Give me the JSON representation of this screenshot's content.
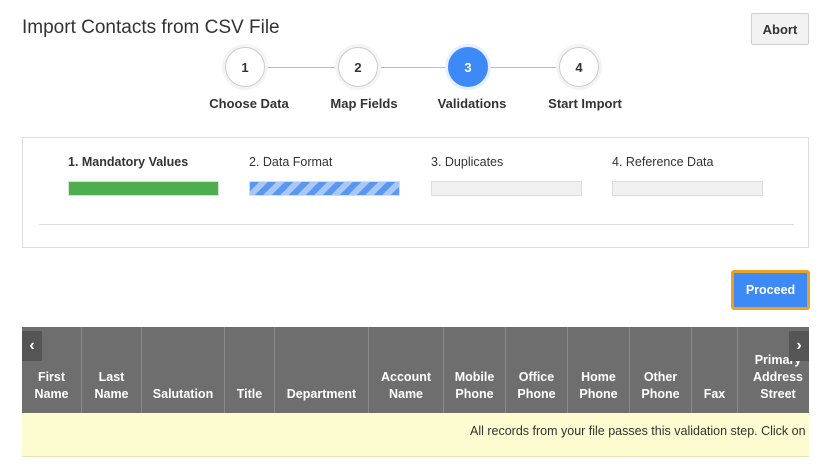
{
  "header": {
    "title": "Import Contacts from CSV File",
    "abort_label": "Abort"
  },
  "steps": [
    {
      "number": "1",
      "label": "Choose Data"
    },
    {
      "number": "2",
      "label": "Map Fields"
    },
    {
      "number": "3",
      "label": "Validations",
      "active": true
    },
    {
      "number": "4",
      "label": "Start Import"
    }
  ],
  "validations": [
    {
      "label": "1. Mandatory Values",
      "progress": 1.0,
      "state": "complete"
    },
    {
      "label": "2. Data Format",
      "progress": 1.0,
      "state": "in-progress"
    },
    {
      "label": "3. Duplicates",
      "progress": 0,
      "state": "pending"
    },
    {
      "label": "4. Reference Data",
      "progress": 0,
      "state": "pending"
    }
  ],
  "proceed_label": "Proceed",
  "grid": {
    "left_arrow": "‹",
    "right_arrow": "›",
    "columns": [
      {
        "line1": "First",
        "line2": "Name"
      },
      {
        "line1": "Last",
        "line2": "Name"
      },
      {
        "line1": "",
        "line2": "Salutation"
      },
      {
        "line1": "",
        "line2": "Title"
      },
      {
        "line1": "",
        "line2": "Department"
      },
      {
        "line1": "Account",
        "line2": "Name"
      },
      {
        "line1": "Mobile",
        "line2": "Phone"
      },
      {
        "line1": "Office",
        "line2": "Phone"
      },
      {
        "line1": "Home",
        "line2": "Phone"
      },
      {
        "line1": "Other",
        "line2": "Phone"
      },
      {
        "line1": "",
        "line2": "Fax"
      },
      {
        "line0": "Primary",
        "line1": "Address",
        "line2": "Street"
      }
    ],
    "message": "All records from your file passes this validation step. Click on 'P"
  },
  "colors": {
    "accent": "#3d8af7",
    "success": "#4cae4c",
    "highlight": "#f0a020",
    "grid_header": "#6e6e6e",
    "message_bg": "#fdfbd0"
  }
}
